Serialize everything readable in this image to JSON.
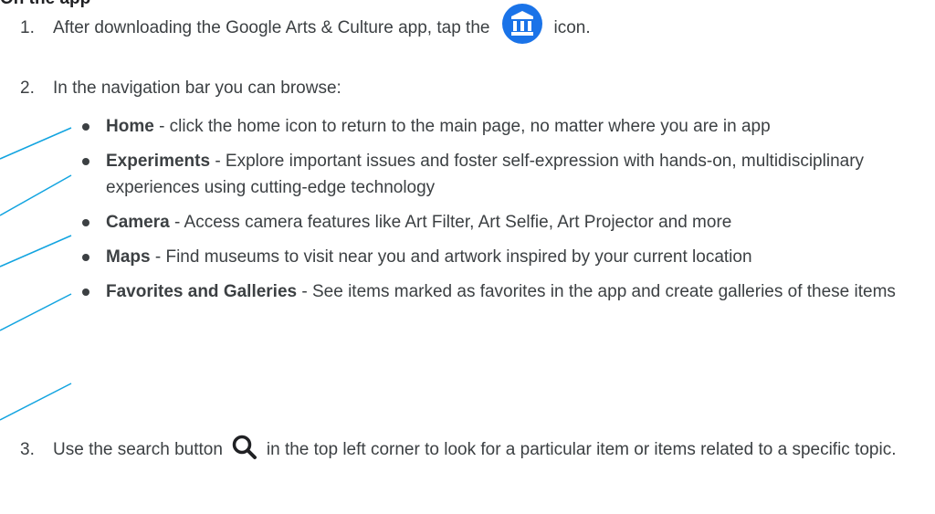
{
  "heading": "On the app",
  "steps": [
    {
      "number": "1.",
      "before_icon": "After downloading the Google Arts & Culture app, tap the",
      "icon": "arts-and-culture-app-icon",
      "after_icon": "icon."
    },
    {
      "number": "2.",
      "text": "In the navigation bar you can browse:"
    },
    {
      "number": "3.",
      "before_icon": "Use the search button",
      "icon": "search-icon",
      "after_icon": "in the top left corner to look for a particular item or items related to a specific topic."
    }
  ],
  "nav_items": [
    {
      "title": "Home",
      "description": " - click the home icon to return to the main page, no matter where you are in app"
    },
    {
      "title": "Experiments",
      "description": " - Explore important issues and foster self-expression with hands-on, multidisciplinary experiences using cutting-edge technology"
    },
    {
      "title": "Camera",
      "description": " - Access camera features like Art Filter, Art Selfie, Art Projector and more"
    },
    {
      "title": "Maps",
      "description": " - Find museums to visit near you and artwork inspired by your current location"
    },
    {
      "title": "Favorites and Galleries",
      "description": " - See items marked as favorites in the app and create galleries of these items"
    }
  ],
  "colors": {
    "text": "#3c4043",
    "accent": "#1a73e8",
    "connector": "#12a4e0"
  }
}
